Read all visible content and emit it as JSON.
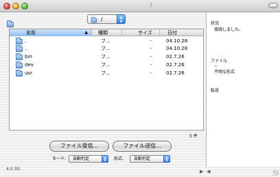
{
  "window": {
    "title": "/"
  },
  "path": {
    "value": "/"
  },
  "table": {
    "headers": {
      "name": "名前",
      "kind": "種類",
      "size": "サイズ",
      "date": "日付"
    },
    "rows": [
      {
        "name": ".",
        "kind": "フ...",
        "size": "-",
        "date": "04.10.28"
      },
      {
        "name": "..",
        "kind": "フ...",
        "size": "-",
        "date": "04.10.28"
      },
      {
        "name": "bin",
        "kind": "フ...",
        "size": "-",
        "date": "02.7.26"
      },
      {
        "name": "dev",
        "kind": "フ...",
        "size": "-",
        "date": "02.7.26"
      },
      {
        "name": "usr",
        "kind": "フ...",
        "size": "-",
        "date": "02.7.26"
      }
    ],
    "count": "5 件"
  },
  "buttons": {
    "receive": "ファイル受信...",
    "send": "ファイル送信..."
  },
  "mode": {
    "label": "モード:",
    "value": "自動判定"
  },
  "format": {
    "label": "形式:",
    "value": "自動判定"
  },
  "version": "4.0.3l1",
  "log": {
    "status_title": "状況",
    "status_text": "接続しました。",
    "file_title": "ファイル",
    "file_dash": "--",
    "file_text": "不明な形式",
    "transfer_title": "転送"
  },
  "icons": {
    "folder": "folder-icon",
    "sort": "triangle-up",
    "window_close": "red-light",
    "window_minimize": "yellow-light",
    "window_zoom": "green-light"
  },
  "colors": {
    "accent_blue": "#2d7fe0",
    "header_blue": "#8fbdf0",
    "folder_blue": "#6e9fd6"
  }
}
